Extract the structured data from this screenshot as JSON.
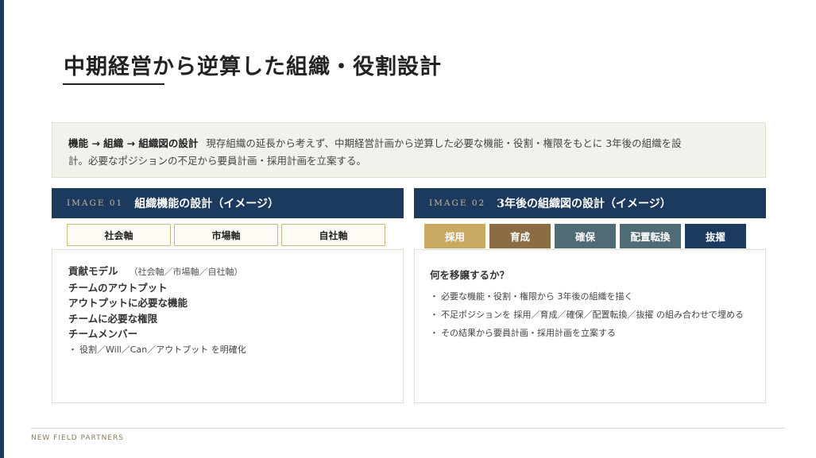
{
  "page": {
    "title": "中期経営から逆算した組織・役割設計",
    "accent_color": "#1c3a5e",
    "gold_color": "#c9a964"
  },
  "summary": {
    "lead": "機能 → 組織 → 組織図の設計",
    "line1": "現存組織の延長から考えず、中期経営計画から逆算した必要な機能・役割・権限をもとに 3年後の組織を設",
    "line2": "計。必要なポジションの不足から要員計画・採用計画を立案する。"
  },
  "left_panel": {
    "tag": "IMAGE 01",
    "title": "組織機能の設計（イメージ）",
    "axes": [
      "社会軸",
      "市場軸",
      "自社軸"
    ],
    "items": [
      {
        "label": "貢献モデル",
        "note": "（社会軸／市場軸／自社軸）"
      },
      {
        "label": "チームのアウトプット",
        "note": ""
      },
      {
        "label": "アウトプットに必要な機能",
        "note": ""
      },
      {
        "label": "チームに必要な権限",
        "note": ""
      },
      {
        "label": "チームメンバー",
        "note": ""
      }
    ],
    "bullet": "役割／Will／Can／アウトプット を明確化"
  },
  "right_panel": {
    "tag": "IMAGE 02",
    "title": "3年後の組織図の設計（イメージ）",
    "phases": [
      {
        "label": "採用",
        "color": "#c9a964"
      },
      {
        "label": "育成",
        "color": "#8a6d45"
      },
      {
        "label": "確保",
        "color": "#4e6b76"
      },
      {
        "label": "配置転換",
        "color": "#4e6b76"
      },
      {
        "label": "抜擢",
        "color": "#1c3a5e"
      }
    ],
    "question": "何を移譲するか？",
    "bullets": [
      "必要な機能・役割・権限から 3年後の組織を描く",
      "不足ポジションを 採用／育成／確保／配置転換／抜擢 の組み合わせで埋める",
      "その結果から要員計画・採用計画を立案する"
    ]
  },
  "footer": {
    "brand": "NEW FIELD PARTNERS"
  }
}
